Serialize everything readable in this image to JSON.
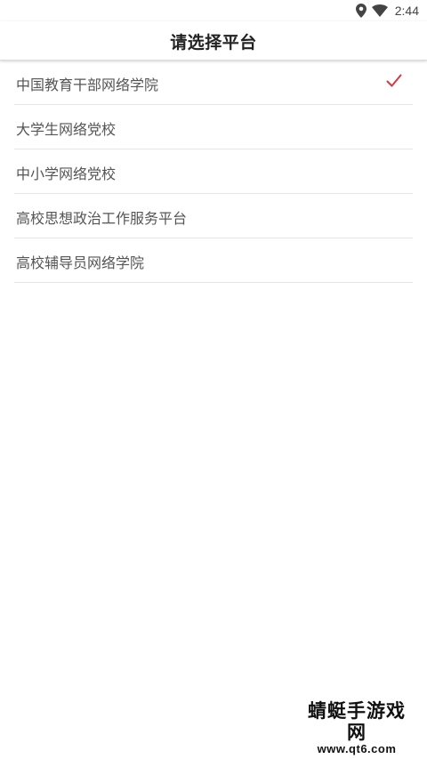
{
  "status_bar": {
    "time": "2:44",
    "icons": [
      "location-icon",
      "wifi-icon"
    ]
  },
  "header": {
    "title": "请选择平台"
  },
  "platforms": [
    {
      "label": "中国教育干部网络学院",
      "selected": true
    },
    {
      "label": "大学生网络党校",
      "selected": false
    },
    {
      "label": "中小学网络党校",
      "selected": false
    },
    {
      "label": "高校思想政治工作服务平台",
      "selected": false
    },
    {
      "label": "高校辅导员网络学院",
      "selected": false
    }
  ],
  "watermark": {
    "title": "蜻蜓手游戏网",
    "url": "www.qt6.com"
  },
  "colors": {
    "check": "#d9363e",
    "text": "#555555",
    "title": "#222222",
    "divider": "#e6e6e6"
  }
}
